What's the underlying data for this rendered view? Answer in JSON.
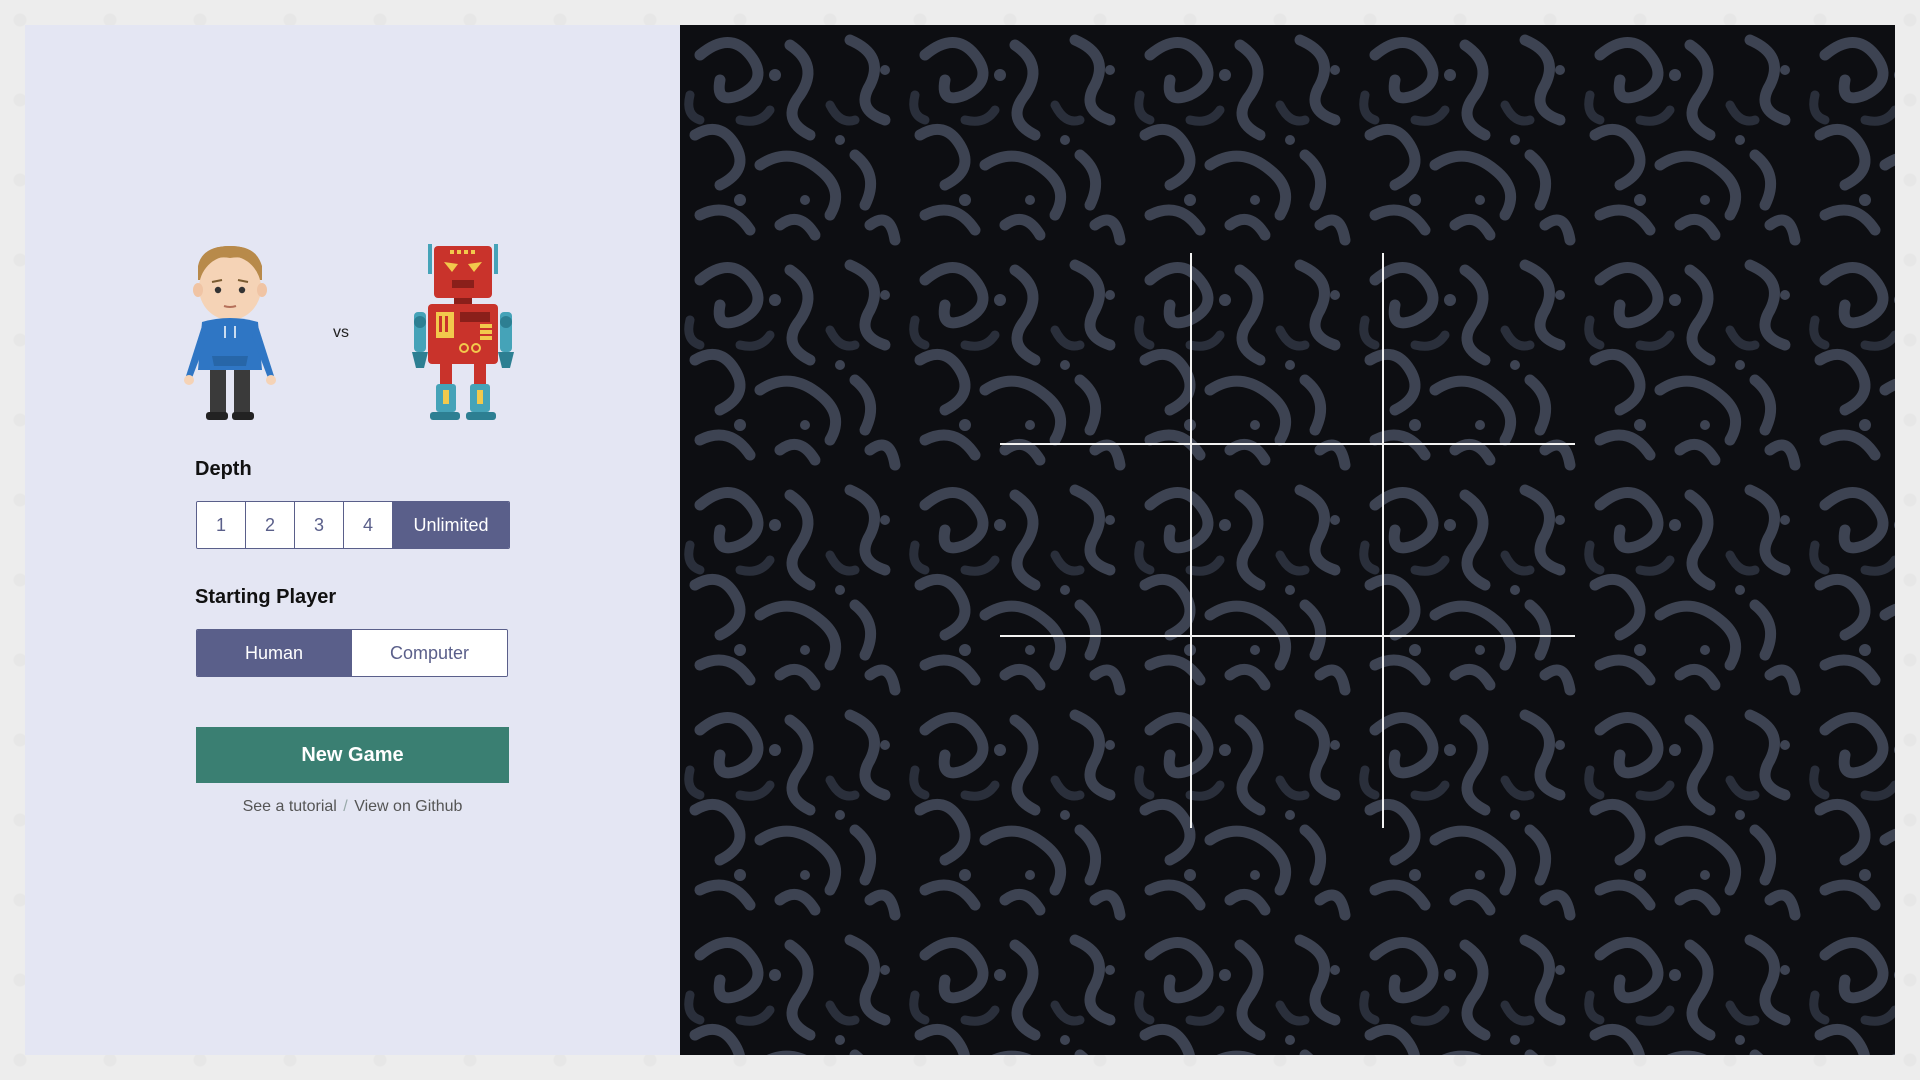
{
  "players": {
    "vs_label": "vs"
  },
  "depth": {
    "label": "Depth",
    "options": [
      "1",
      "2",
      "3",
      "4",
      "Unlimited"
    ],
    "selected": "Unlimited"
  },
  "starting_player": {
    "label": "Starting Player",
    "options": [
      "Human",
      "Computer"
    ],
    "selected": "Human"
  },
  "actions": {
    "new_game_label": "New Game"
  },
  "links": {
    "tutorial": "See a tutorial",
    "separator": "/",
    "github": "View on Github"
  },
  "board": {
    "cells": [
      "",
      "",
      "",
      "",
      "",
      "",
      "",
      "",
      ""
    ]
  },
  "colors": {
    "panel_bg": "#e4e6f3",
    "accent": "#5a5f8a",
    "new_game": "#3a7f72",
    "board_bg": "#0d0e12",
    "pattern": "#4a5060"
  }
}
